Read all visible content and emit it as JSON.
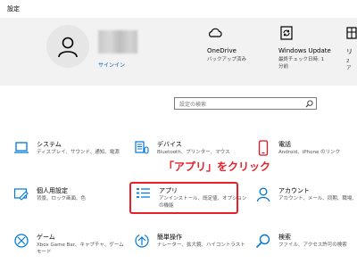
{
  "window": {
    "title": "設定"
  },
  "header": {
    "signin": "サインイン",
    "items": [
      {
        "name": "OneDrive",
        "desc": [
          "バックアップ済み"
        ],
        "icon": "cloud-icon"
      },
      {
        "name": "Windows Update",
        "desc": [
          "最終チェック日時: 1",
          "分前"
        ],
        "icon": "sync-icon"
      },
      {
        "name": "リ",
        "desc": [
          "2",
          "ア"
        ],
        "icon": "reward-icon"
      }
    ]
  },
  "search": {
    "placeholder": "設定の検索"
  },
  "grid": {
    "system": {
      "name": "システム",
      "desc": [
        "ディスプレイ、サウンド、通知、電源"
      ]
    },
    "devices": {
      "name": "デバイス",
      "desc": [
        "Bluetooth、プリンター、マウス"
      ]
    },
    "phone": {
      "name": "電話",
      "desc": [
        "Android、iPhone のリンク"
      ]
    },
    "personal": {
      "name": "個人用設定",
      "desc": [
        "背景、ロック画面、色"
      ]
    },
    "apps": {
      "name": "アプリ",
      "desc": [
        "アンインストール、既定値、オプション",
        "の機能"
      ]
    },
    "accounts": {
      "name": "アカウント",
      "desc": [
        "アカウント、メール、同期、職場、家族"
      ]
    },
    "gaming": {
      "name": "ゲーム",
      "desc": [
        "Xbox Game Bar、キャプチャ、ゲーム",
        "モード"
      ]
    },
    "ease": {
      "name": "簡単操作",
      "desc": [
        "ナレーター、拡大鏡、ハイコントラスト"
      ]
    },
    "search": {
      "name": "検索",
      "desc": [
        "ファイル、アクセス許可の検索"
      ]
    }
  },
  "annotation": {
    "text": "「アプリ」をクリック",
    "color": "#e8202a"
  },
  "colors": {
    "accent": "#0063b1",
    "icon": "#0078d7",
    "header_bg": "#f2f2f2"
  }
}
